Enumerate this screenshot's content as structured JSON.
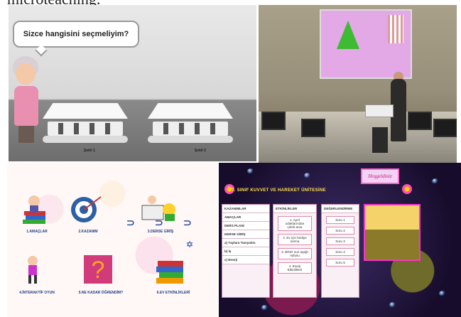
{
  "top_caption": "microteaching.",
  "panel1": {
    "speech": "Sizce hangisini seçmeliyim?",
    "table_left_label": "Şekil 1",
    "table_right_label": "Şekil 2"
  },
  "panel3": {
    "items": [
      {
        "label": "1.AMAÇLAR",
        "icon": "books-icon"
      },
      {
        "label": "2.KAZANIM",
        "icon": "target-icon"
      },
      {
        "label": "3.DERSE GİRİŞ",
        "icon": "teacher-icon"
      },
      {
        "label": "4.İNTERAKTİF OYUN",
        "icon": "player-icon"
      },
      {
        "label": "5.NE KADAR ÖĞRENDİM?",
        "icon": "question-icon"
      },
      {
        "label": "6.EV ETKİNLİKLERİ",
        "icon": "homework-books-icon"
      }
    ]
  },
  "panel4": {
    "title": "7. SINIF KUVVET VE HAREKET ÜNİTESİNE",
    "greeting": "Hoşgeldiniz",
    "left_menu": [
      "KAZANIMLAR",
      "AMAÇLAR",
      "DERS PLANI",
      "DERSE GİRİŞ",
      "a) Yaylara Tanıyalım",
      "b) İş",
      "c) Enerji"
    ],
    "mid_menu": [
      "ETKİNLİKLER",
      "1. Ayrıl odaklarından çıktık ama",
      "2. Ev için hediye sorma",
      "3. BİNO nun aşağı nüfusu",
      "4. Enerji Etkinlikleri"
    ],
    "right_menu": [
      "DEĞERLENDİRME",
      "Soru 1",
      "Soru 2",
      "Soru 3",
      "Soru 4",
      "Soru 5"
    ]
  },
  "colors": {
    "accent_blue": "#1f3d8a",
    "pink_border": "#ff66cc",
    "title_yellow": "#ffe24a"
  }
}
